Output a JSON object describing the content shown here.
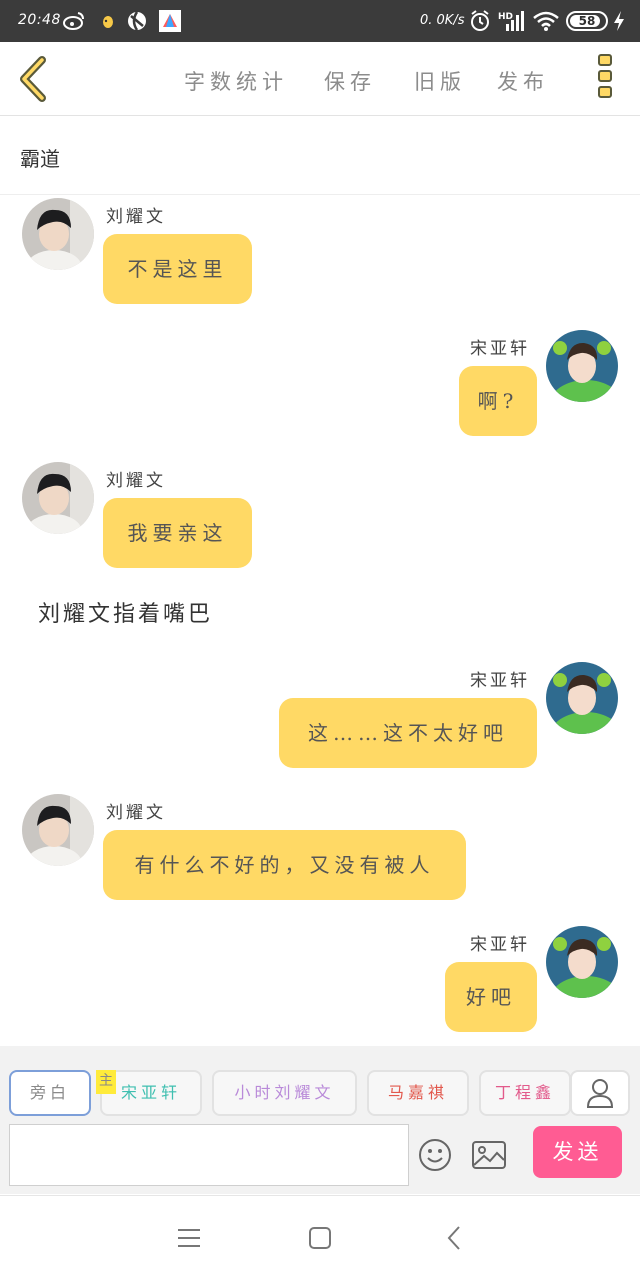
{
  "status_bar": {
    "time": "20:48",
    "net_speed": "0. 0K/s",
    "battery": "58",
    "icons": [
      "weibo-icon",
      "app-icon",
      "browser-icon",
      "store-icon",
      "alarm-icon",
      "signal-icon",
      "wifi-icon",
      "charging-icon"
    ],
    "network_label": "HD"
  },
  "toolbar": {
    "word_count": "字数统计",
    "save": "保存",
    "old_version": "旧版",
    "publish": "发布",
    "icons": [
      "chevron-left-icon",
      "more-menu-icon"
    ]
  },
  "chapter": {
    "title": "霸道"
  },
  "messages": [
    {
      "side": "left",
      "sender": "刘耀文",
      "text": "不是这里"
    },
    {
      "side": "right",
      "sender": "宋亚轩",
      "text": "啊?"
    },
    {
      "side": "left",
      "sender": "刘耀文",
      "text": "我要亲这"
    },
    {
      "type": "narration",
      "text": "刘耀文指着嘴巴"
    },
    {
      "side": "right",
      "sender": "宋亚轩",
      "text": "这……这不太好吧"
    },
    {
      "side": "left",
      "sender": "刘耀文",
      "text": "有什么不好的，又没有被人"
    },
    {
      "side": "right",
      "sender": "宋亚轩",
      "text": "好吧"
    }
  ],
  "composer": {
    "roles": [
      {
        "label": "旁白",
        "color": "#8a8a8a",
        "active": true
      },
      {
        "label": "宋亚轩",
        "color": "#3fbfb0",
        "main": true
      },
      {
        "label": "小时刘耀文",
        "color": "#b98ad9"
      },
      {
        "label": "马嘉祺",
        "color": "#e2584d"
      },
      {
        "label": "丁程鑫",
        "color": "#e25a8b"
      }
    ],
    "main_tag": "主",
    "input_value": "",
    "send": "发送",
    "accent": "#ffd965",
    "send_color": "#ff5c93"
  },
  "nav": {
    "icons": [
      "menu-icon",
      "home-icon",
      "back-icon"
    ]
  }
}
